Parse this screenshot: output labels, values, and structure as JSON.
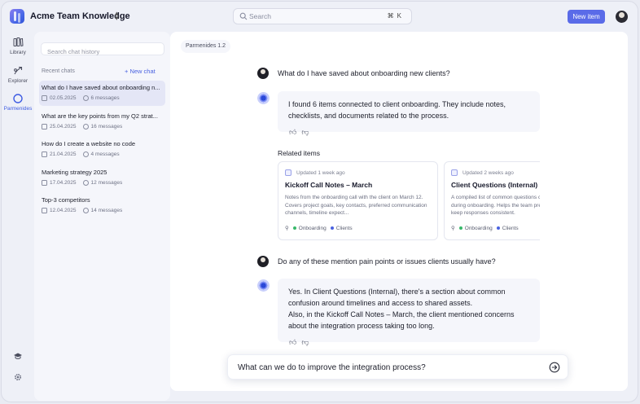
{
  "header": {
    "workspace_title": "Acme Team Knowledge",
    "switch_icon": "chevron-up-down-icon",
    "search_placeholder": "Search",
    "shortcut": "⌘K",
    "new_item_label": "New item"
  },
  "rail": {
    "items": [
      {
        "label": "Library",
        "icon": "library-icon"
      },
      {
        "label": "Explorer",
        "icon": "explorer-icon"
      },
      {
        "label": "Parmenides",
        "icon": "parmenides-icon",
        "active": true
      }
    ],
    "bottom_icons": [
      "graduation-cap-icon",
      "gear-icon"
    ]
  },
  "sidebar": {
    "search_placeholder": "Search chat history",
    "recent_label": "Recent chats",
    "new_chat_label": "+ New chat",
    "chats": [
      {
        "title": "What do I have saved about onboarding n...",
        "date": "02.05.2025",
        "messages": "6 messages",
        "active": true
      },
      {
        "title": "What are the key points from my Q2 strat...",
        "date": "25.04.2025",
        "messages": "16 messages"
      },
      {
        "title": "How do I create a website no code",
        "date": "21.04.2025",
        "messages": "4 messages"
      },
      {
        "title": "Marketing strategy 2025",
        "date": "17.04.2025",
        "messages": "12 messages"
      },
      {
        "title": "Top-3 competitors",
        "date": "12.04.2025",
        "messages": "14 messages"
      }
    ]
  },
  "main": {
    "model_label": "Parmenides 1.2",
    "q1": "What do I have saved about onboarding new clients?",
    "a1": "I found 6 items connected to client onboarding. They include notes, checklists, and documents related to the process.",
    "related_title": "Related items",
    "cards": [
      {
        "updated": "Updated 1 week ago",
        "title": "Kickoff Call Notes – March",
        "desc": "Notes from the onboarding call with the client on March 12. Covers project goals, key contacts, preferred communication channels, timeline expect...",
        "tags": [
          "Onboarding",
          "Clients"
        ]
      },
      {
        "updated": "Updated 2 weeks ago",
        "title": "Client Questions (Internal)",
        "desc": "A compiled list of common questions clients typically ask during onboarding. Helps the team prepare answers and keep responses consistent.",
        "tags": [
          "Onboarding",
          "Clients"
        ]
      }
    ],
    "q2": "Do any of these mention pain points or issues clients usually have?",
    "a2_line1": "Yes. In Client Questions (Internal), there's a section about common confusion around timelines and access to shared assets.",
    "a2_line2": "Also, in the Kickoff Call Notes – March, the client mentioned concerns about the integration process taking too long.",
    "input_value": "What can we do to improve the integration process?",
    "send_icon": "send-arrow-icon"
  },
  "colors": {
    "accent": "#5a6be8",
    "active_rail": "#3e5ce2",
    "tag_green": "#39b86a",
    "tag_blue": "#4a62e0"
  }
}
